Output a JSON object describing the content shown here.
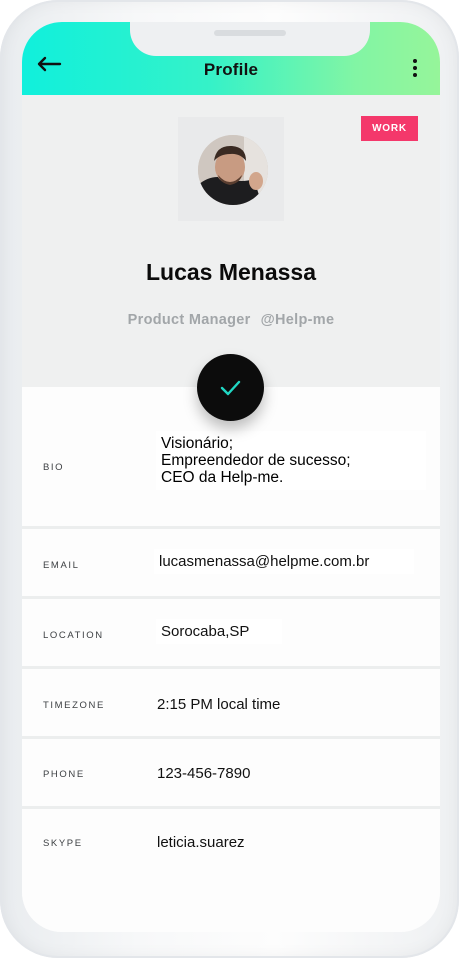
{
  "header": {
    "back_icon": "arrow-left-icon",
    "title": "Profile",
    "menu_icon": "more-vertical-icon",
    "gradient": [
      "#10f0dc",
      "#96f59a"
    ]
  },
  "profile": {
    "badge": "WORK",
    "badge_color": "#f4386b",
    "name": "Lucas Menassa",
    "role": "Product Manager",
    "company": "@Help-me",
    "action_icon": "checkmark-icon",
    "action_icon_color": "#20d7c3"
  },
  "details": {
    "bio": {
      "label": "BIO",
      "lines": [
        "Visionário;",
        "Empreendedor de sucesso;",
        "CEO da Help-me."
      ]
    },
    "email": {
      "label": "EMAIL",
      "value": "lucasmenassa@helpme.com.br"
    },
    "location": {
      "label": "LOCATION",
      "value": "Sorocaba,SP"
    },
    "timezone": {
      "label": "TIMEZONE",
      "value": "2:15 PM local time"
    },
    "phone": {
      "label": "PHONE",
      "value": "123-456-7890"
    },
    "skype": {
      "label": "SKYPE",
      "value": "leticia.suarez"
    }
  }
}
